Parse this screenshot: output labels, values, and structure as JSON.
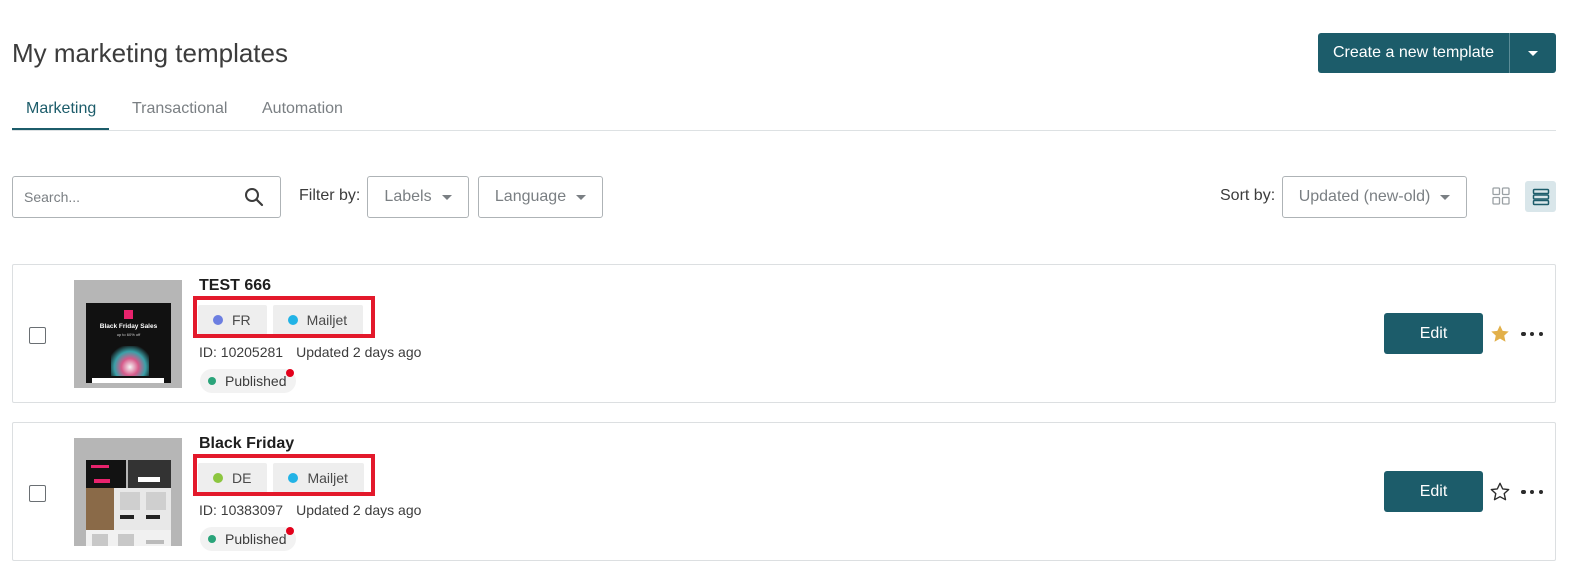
{
  "header": {
    "title": "My marketing templates",
    "create_button_label": "Create a new template"
  },
  "tabs": [
    {
      "label": "Marketing",
      "active": true
    },
    {
      "label": "Transactional",
      "active": false
    },
    {
      "label": "Automation",
      "active": false
    }
  ],
  "toolbar": {
    "search_placeholder": "Search...",
    "filter_label": "Filter by:",
    "labels_dropdown": "Labels",
    "language_dropdown": "Language",
    "sort_label": "Sort by:",
    "sort_value": "Updated (new-old)",
    "view_mode": "list"
  },
  "templates": [
    {
      "name": "TEST 666",
      "tags": [
        {
          "label": "FR",
          "color": "#6c7ee1"
        },
        {
          "label": "Mailjet",
          "color": "#22b3e6"
        }
      ],
      "id_text": "ID: 10205281",
      "updated_text": "Updated 2 days ago",
      "status": "Published",
      "edit_label": "Edit",
      "favorite": true,
      "thumbnail_text": "Black Friday Sales",
      "thumbnail_subtext": "up to 60% off"
    },
    {
      "name": "Black Friday",
      "tags": [
        {
          "label": "DE",
          "color": "#8cc63f"
        },
        {
          "label": "Mailjet",
          "color": "#22b3e6"
        }
      ],
      "id_text": "ID: 10383097",
      "updated_text": "Updated 2 days ago",
      "status": "Published",
      "edit_label": "Edit",
      "favorite": false
    }
  ],
  "colors": {
    "primary": "#1c5c6a",
    "highlight": "#e3192b",
    "favorite": "#e2b04a",
    "published": "#2aa47a"
  }
}
